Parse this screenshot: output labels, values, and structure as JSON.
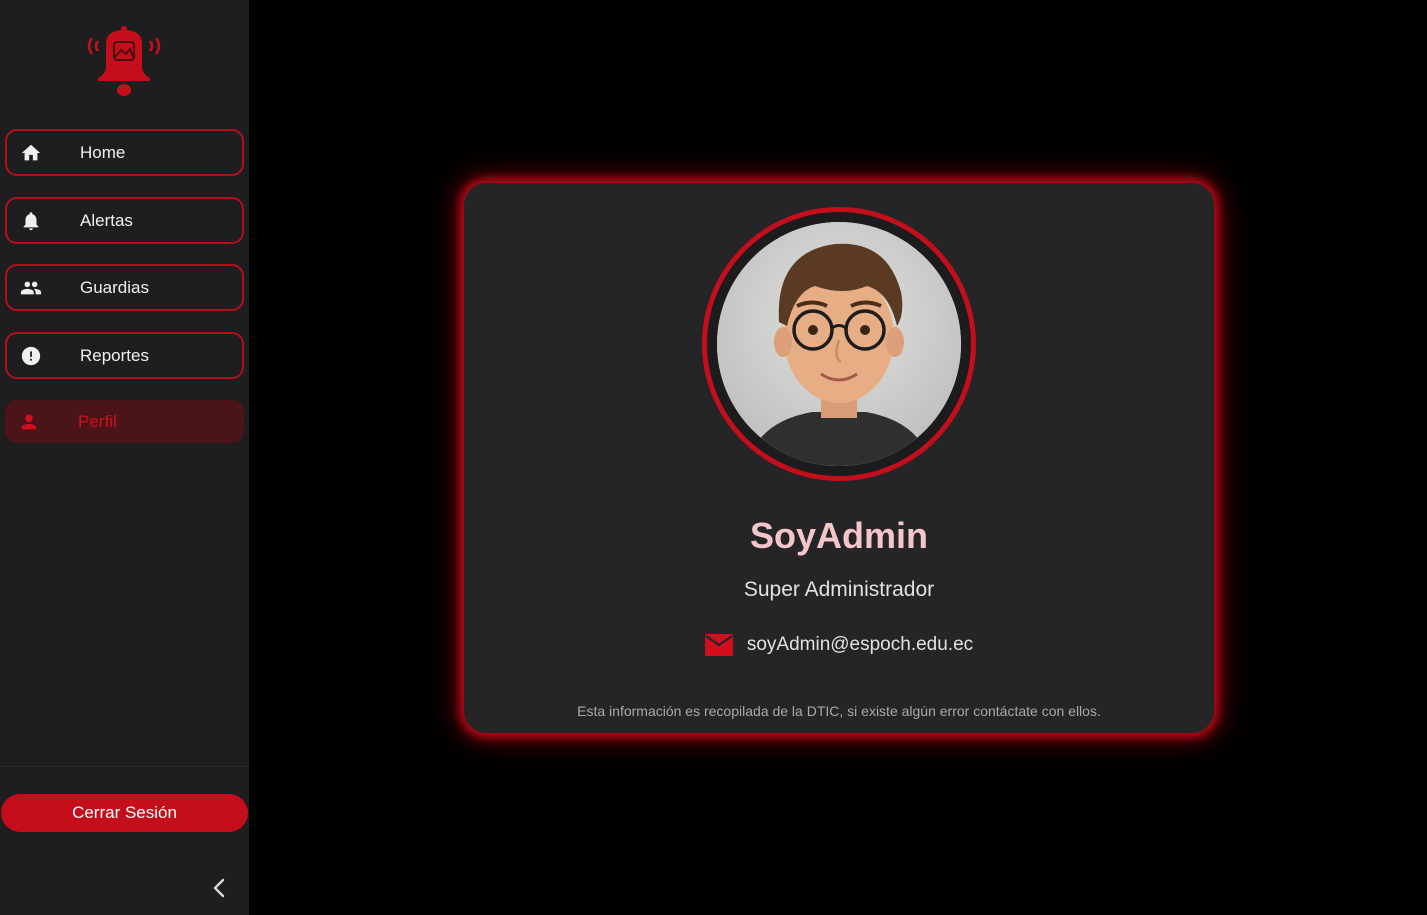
{
  "sidebar": {
    "logo_icon": "alarm-bell-logo",
    "items": [
      {
        "label": "Home",
        "icon": "home-icon"
      },
      {
        "label": "Alertas",
        "icon": "bell-icon"
      },
      {
        "label": "Guardias",
        "icon": "people-icon"
      },
      {
        "label": "Reportes",
        "icon": "alert-circle-icon"
      },
      {
        "label": "Perfil",
        "icon": "person-icon",
        "active": true
      }
    ],
    "logout_label": "Cerrar Sesión",
    "collapse_icon": "chevron-left-icon"
  },
  "profile": {
    "username": "SoyAdmin",
    "role": "Super Administrador",
    "email": "soyAdmin@espoch.edu.ec",
    "note": "Esta información es recopilada de la DTIC, si existe algún error contáctate con ellos."
  },
  "colors": {
    "accent": "#c50e1b",
    "sidebar_bg": "#1e1e20",
    "card_bg": "#252527",
    "username": "#f5c6c9",
    "active_bg": "#4a1418"
  }
}
